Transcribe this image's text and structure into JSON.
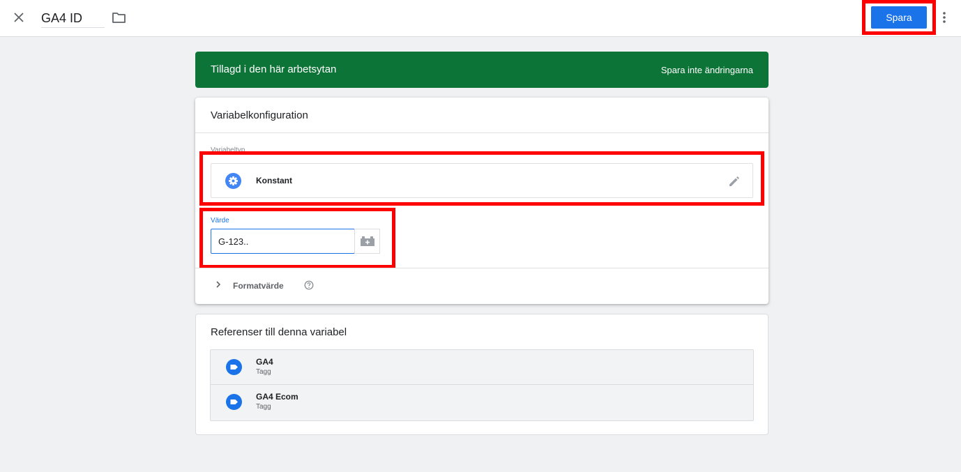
{
  "topbar": {
    "title": "GA4 ID",
    "save_label": "Spara"
  },
  "banner": {
    "text": "Tillagd i den här arbetsytan",
    "action": "Spara inte ändringarna"
  },
  "config": {
    "title": "Variabelkonfiguration",
    "type_label": "Variabeltyp",
    "type_name": "Konstant",
    "value_label": "Värde",
    "value": "G-123..",
    "format_label": "Formatvärde"
  },
  "references": {
    "title": "Referenser till denna variabel",
    "items": [
      {
        "name": "GA4",
        "type": "Tagg"
      },
      {
        "name": "GA4 Ecom",
        "type": "Tagg"
      }
    ]
  },
  "colors": {
    "accent": "#1a73e8",
    "banner": "#0d7437",
    "highlight": "#ff0000"
  },
  "icons": {
    "close": "close-icon",
    "folder": "folder-icon",
    "more": "more-vert-icon",
    "type": "gear-icon",
    "edit": "pencil-icon",
    "var_picker": "variable-brick-icon",
    "chevron": "chevron-right-icon",
    "help": "help-icon",
    "tag": "tag-icon"
  }
}
